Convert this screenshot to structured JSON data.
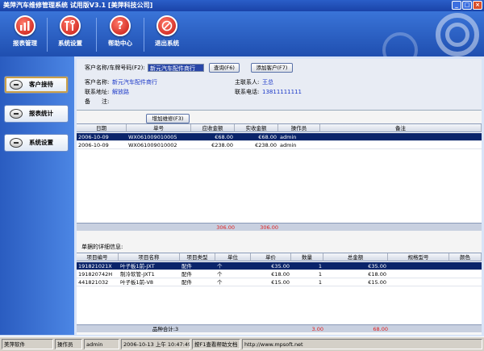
{
  "window": {
    "title": "美萍汽车维修管理系统 试用版V3.1 [美萍科技公司]"
  },
  "toolbar": [
    {
      "label": "报表管理",
      "icon": "bar-chart-icon"
    },
    {
      "label": "系统设置",
      "icon": "tools-icon"
    },
    {
      "label": "帮助中心",
      "icon": "help-icon"
    },
    {
      "label": "退出系统",
      "icon": "exit-icon"
    }
  ],
  "sidebar": [
    {
      "label": "客户接待"
    },
    {
      "label": "报表统计"
    },
    {
      "label": "系统设置"
    }
  ],
  "form": {
    "search_label": "客户名称/车牌号码(F2):",
    "search_value": "新元汽车配件商行",
    "query_btn": "查询(F6)",
    "add_btn": "添加客户(F7)",
    "name_label": "客户名称:",
    "name_value": "新元汽车配件商行",
    "contact_label": "主联系人:",
    "contact_value": "王总",
    "addr_label": "联系地址:",
    "addr_value": "解放路",
    "phone_label": "联系电话:",
    "phone_value": "13811111111",
    "note_label": "备　　注:",
    "add_repair_btn": "增加维修(F3)"
  },
  "orders": {
    "columns": [
      "日期",
      "单号",
      "应收金额",
      "实收金额",
      "操作员",
      "备注"
    ],
    "rows": [
      [
        "2006-10-09",
        "WX061009010005",
        "€68.00",
        "€68.00",
        "admin",
        ""
      ],
      [
        "2006-10-09",
        "WX061009010002",
        "€238.00",
        "€238.00",
        "admin",
        ""
      ]
    ],
    "sum_receivable": "306.00",
    "sum_received": "306.00"
  },
  "details": {
    "title": "单据的详细信息:",
    "columns": [
      "项目编号",
      "项目名称",
      "项目类型",
      "单位",
      "单价",
      "数量",
      "总金额",
      "规格型号",
      "颜色"
    ],
    "rows": [
      [
        "191821021X",
        "叶子板1前-JXT",
        "配件",
        "个",
        "€35.00",
        "1",
        "€35.00",
        "",
        ""
      ],
      [
        "191820742H",
        "制冷软管-JXT1",
        "配件",
        "个",
        "€18.00",
        "1",
        "€18.00",
        "",
        ""
      ],
      [
        "441821032",
        "叶子板1前-V8",
        "配件",
        "个",
        "€15.00",
        "1",
        "€15.00",
        "",
        ""
      ]
    ],
    "total_label": "品种合计:3",
    "total_qty": "3.00",
    "total_amount": "68.00"
  },
  "statusbar": {
    "app": "美萍软件",
    "operator_label": "操作员",
    "operator": "admin",
    "datetime": "2006-10-13 上午 10:47:49",
    "hint": "按F1查看帮助文档",
    "url": "http://www.mpsoft.net"
  }
}
